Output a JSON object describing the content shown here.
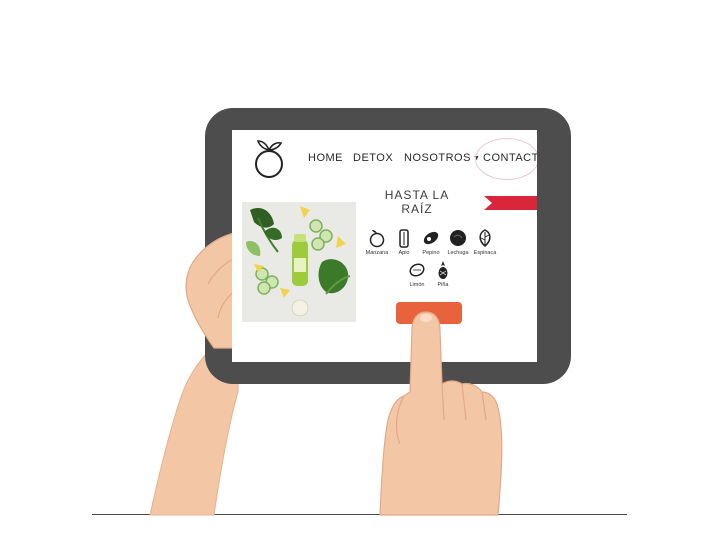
{
  "nav": {
    "home": "HOME",
    "detox": "DETOX",
    "nosotros": "NOSOTROS",
    "contacto": "CONTACTO"
  },
  "section": {
    "title": "HASTA LA RAÍZ"
  },
  "ingredients": [
    {
      "label": "Manzana",
      "icon": "apple-icon"
    },
    {
      "label": "Apio",
      "icon": "celery-icon"
    },
    {
      "label": "Pepino",
      "icon": "cucumber-icon"
    },
    {
      "label": "Lechuga",
      "icon": "lettuce-icon"
    },
    {
      "label": "Espinaca",
      "icon": "spinach-icon"
    },
    {
      "label": "Limón",
      "icon": "lemon-icon"
    },
    {
      "label": "Piña",
      "icon": "pineapple-icon"
    }
  ],
  "colors": {
    "tablet_frame": "#4d4d4d",
    "cta": "#e8623b",
    "ribbon": "#d9263a",
    "contact_highlight": "#f1c6d2",
    "skin": "#f3c7a6"
  }
}
